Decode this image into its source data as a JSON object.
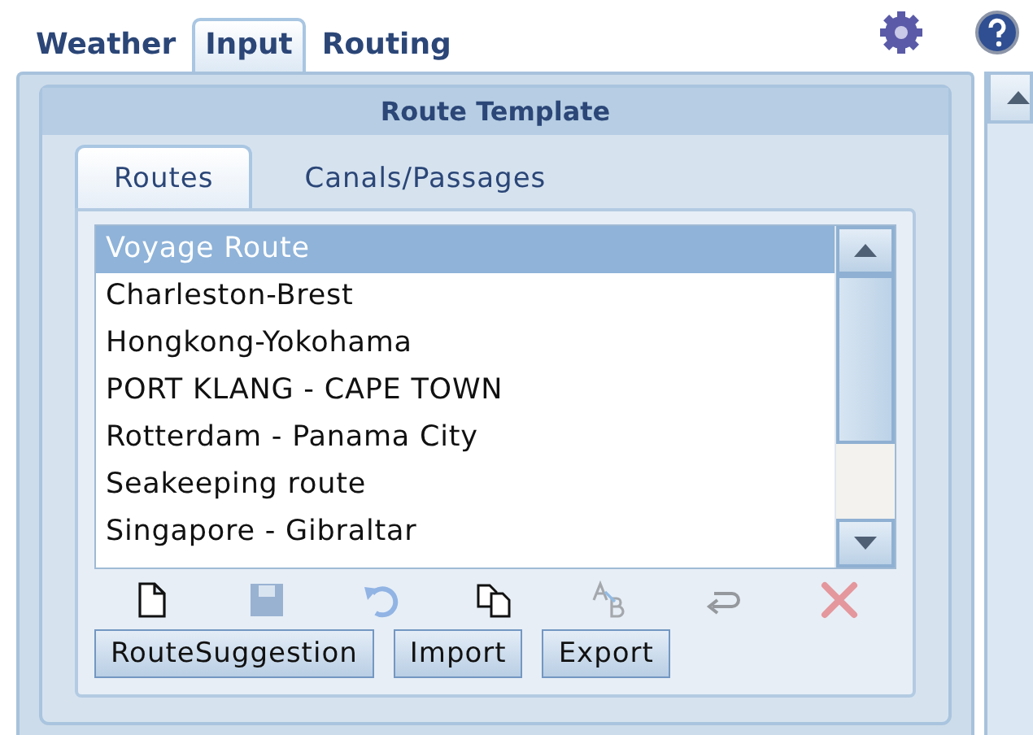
{
  "top_tabs": [
    {
      "label": "Weather",
      "selected": false
    },
    {
      "label": "Input",
      "selected": true
    },
    {
      "label": "Routing",
      "selected": false
    }
  ],
  "panel": {
    "title": "Route Template",
    "sub_tabs": [
      {
        "label": "Routes",
        "selected": true
      },
      {
        "label": "Canals/Passages",
        "selected": false
      }
    ],
    "routes": [
      {
        "label": "Voyage Route",
        "selected": true
      },
      {
        "label": "Charleston-Brest",
        "selected": false
      },
      {
        "label": "Hongkong-Yokohama",
        "selected": false
      },
      {
        "label": "PORT KLANG - CAPE TOWN",
        "selected": false
      },
      {
        "label": "Rotterdam - Panama City",
        "selected": false
      },
      {
        "label": "Seakeeping route",
        "selected": false
      },
      {
        "label": "Singapore - Gibraltar",
        "selected": false
      }
    ],
    "tools": [
      {
        "kind": "new",
        "disabled": false
      },
      {
        "kind": "save",
        "disabled": true
      },
      {
        "kind": "undo",
        "disabled": true
      },
      {
        "kind": "copy",
        "disabled": false
      },
      {
        "kind": "rename",
        "disabled": true
      },
      {
        "kind": "redo",
        "disabled": true
      },
      {
        "kind": "delete",
        "disabled": true
      }
    ],
    "buttons": [
      "RouteSuggestion",
      "Import",
      "Export"
    ]
  }
}
